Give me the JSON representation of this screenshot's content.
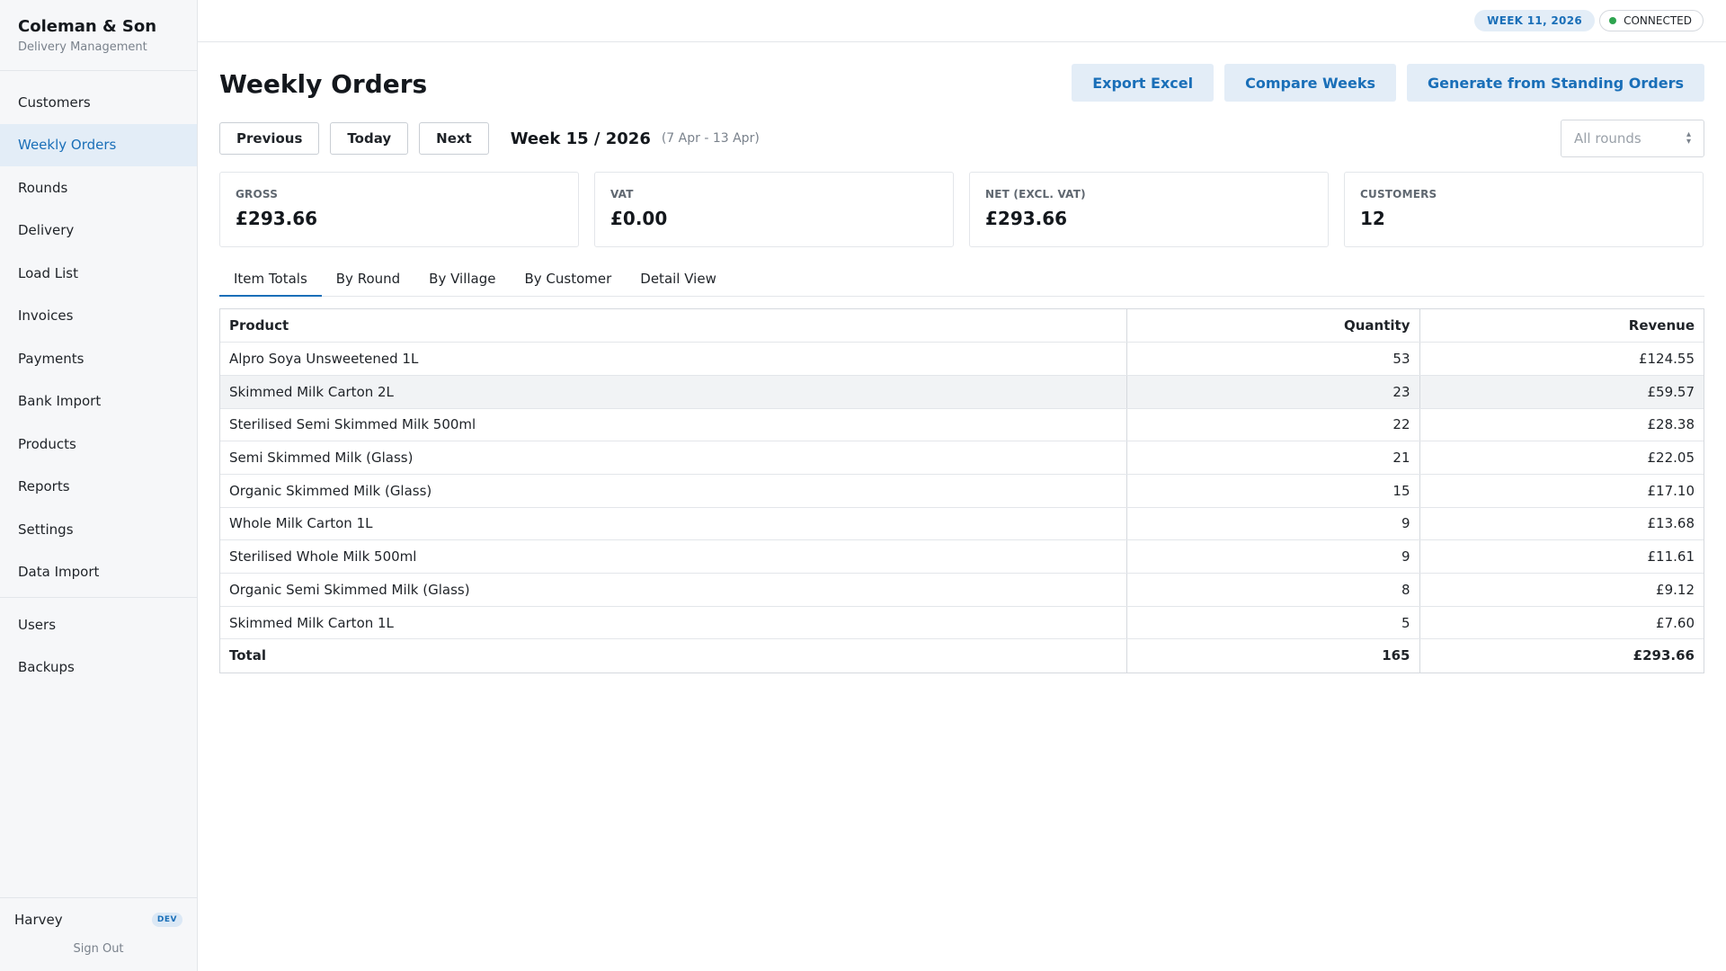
{
  "brand": {
    "name": "Coleman & Son",
    "subtitle": "Delivery Management"
  },
  "sidebar": {
    "items": [
      {
        "label": "Customers",
        "active": false
      },
      {
        "label": "Weekly Orders",
        "active": true
      },
      {
        "label": "Rounds",
        "active": false
      },
      {
        "label": "Delivery",
        "active": false
      },
      {
        "label": "Load List",
        "active": false
      },
      {
        "label": "Invoices",
        "active": false
      },
      {
        "label": "Payments",
        "active": false
      },
      {
        "label": "Bank Import",
        "active": false
      },
      {
        "label": "Products",
        "active": false
      },
      {
        "label": "Reports",
        "active": false
      },
      {
        "label": "Settings",
        "active": false
      },
      {
        "label": "Data Import",
        "active": false
      }
    ],
    "admin_items": [
      {
        "label": "Users"
      },
      {
        "label": "Backups"
      }
    ],
    "user": {
      "name": "Harvey",
      "badge": "DEV",
      "sign_out": "Sign Out"
    }
  },
  "topbar": {
    "week_pill": "WEEK 11, 2026",
    "status": "CONNECTED",
    "status_color": "#2ea44f"
  },
  "page": {
    "title": "Weekly Orders",
    "actions": {
      "export": "Export Excel",
      "compare": "Compare Weeks",
      "generate": "Generate from Standing Orders"
    },
    "nav": {
      "previous": "Previous",
      "today": "Today",
      "next": "Next"
    },
    "week_label": "Week 15 / 2026",
    "week_range": "(7 Apr - 13 Apr)",
    "round_filter": {
      "selected": "All rounds"
    }
  },
  "stats": [
    {
      "label": "GROSS",
      "value": "£293.66"
    },
    {
      "label": "VAT",
      "value": "£0.00"
    },
    {
      "label": "NET (EXCL. VAT)",
      "value": "£293.66"
    },
    {
      "label": "CUSTOMERS",
      "value": "12"
    }
  ],
  "tabs": [
    {
      "label": "Item Totals",
      "active": true
    },
    {
      "label": "By Round",
      "active": false
    },
    {
      "label": "By Village",
      "active": false
    },
    {
      "label": "By Customer",
      "active": false
    },
    {
      "label": "Detail View",
      "active": false
    }
  ],
  "table": {
    "headers": {
      "product": "Product",
      "quantity": "Quantity",
      "revenue": "Revenue"
    },
    "rows": [
      {
        "product": "Alpro Soya Unsweetened 1L",
        "quantity": "53",
        "revenue": "£124.55"
      },
      {
        "product": "Skimmed Milk Carton 2L",
        "quantity": "23",
        "revenue": "£59.57"
      },
      {
        "product": "Sterilised Semi Skimmed Milk 500ml",
        "quantity": "22",
        "revenue": "£28.38"
      },
      {
        "product": "Semi Skimmed Milk (Glass)",
        "quantity": "21",
        "revenue": "£22.05"
      },
      {
        "product": "Organic Skimmed Milk (Glass)",
        "quantity": "15",
        "revenue": "£17.10"
      },
      {
        "product": "Whole Milk Carton 1L",
        "quantity": "9",
        "revenue": "£13.68"
      },
      {
        "product": "Sterilised Whole Milk 500ml",
        "quantity": "9",
        "revenue": "£11.61"
      },
      {
        "product": "Organic Semi Skimmed Milk (Glass)",
        "quantity": "8",
        "revenue": "£9.12"
      },
      {
        "product": "Skimmed Milk Carton 1L",
        "quantity": "5",
        "revenue": "£7.60"
      }
    ],
    "total": {
      "label": "Total",
      "quantity": "165",
      "revenue": "£293.66"
    }
  },
  "colors": {
    "accent": "#1a6fb8",
    "accent_bg": "#e3edf7"
  }
}
